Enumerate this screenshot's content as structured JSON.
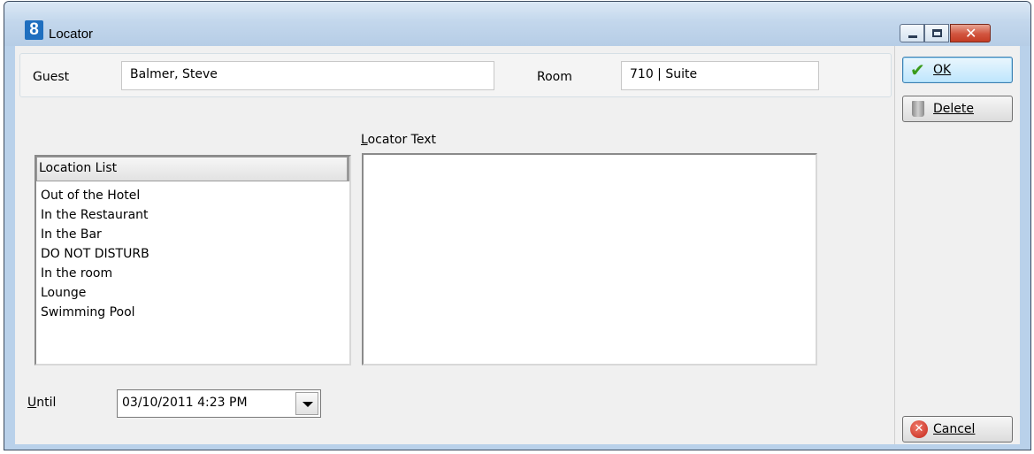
{
  "window": {
    "icon_text": "8",
    "title": "Locator",
    "close_glyph": "✕"
  },
  "guest": {
    "label": "Guest",
    "value": "Balmer, Steve"
  },
  "room": {
    "label": "Room",
    "value": "710  |  Suite"
  },
  "buttons": {
    "ok": {
      "label": "OK",
      "icon": "check-icon"
    },
    "delete": {
      "label": "Delete",
      "icon": "trash-icon"
    },
    "cancel": {
      "label": "Cancel",
      "icon": "cancel-icon"
    }
  },
  "location_list": {
    "header": "Location List",
    "items": [
      "Out of the Hotel",
      "In the Restaurant",
      "In the Bar",
      "DO NOT DISTURB",
      "In the room",
      "Lounge",
      "Swimming Pool"
    ]
  },
  "locator_text": {
    "label": "Locator Text",
    "value": ""
  },
  "until": {
    "label": "Until",
    "value": "03/10/2011 4:23 PM"
  },
  "colors": {
    "titlebar": "#b9d1ea",
    "client_bg": "#f0f0f0",
    "close_button": "#c43c24",
    "ok_check": "#3a9b1a",
    "cancel_red": "#c4261a"
  }
}
